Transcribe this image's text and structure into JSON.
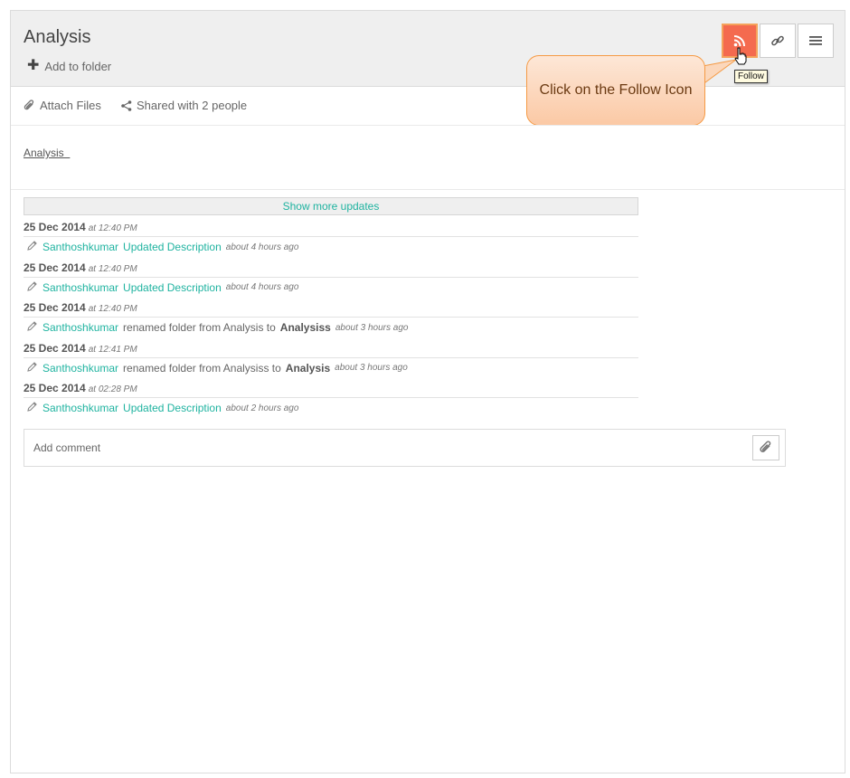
{
  "header": {
    "title": "Analysis",
    "add_to_folder": "Add to folder",
    "follow_tooltip": "Follow",
    "accent_color": "#f46a4f",
    "icons": [
      "rss-icon",
      "link-icon",
      "hamburger-menu-icon"
    ]
  },
  "callout": {
    "text": "Click on the Follow Icon"
  },
  "actions": {
    "attach_files": "Attach Files",
    "shared_with": "Shared with 2 people"
  },
  "description": {
    "link_text": "Analysis  "
  },
  "show_more": "Show more updates",
  "updates": [
    {
      "date": "25 Dec 2014",
      "time": "at 12:40 PM",
      "user": "Santhoshkumar",
      "action": "Updated Description",
      "action_type": "link",
      "ago": "about 4 hours ago"
    },
    {
      "date": "25 Dec 2014",
      "time": "at 12:40 PM",
      "user": "Santhoshkumar",
      "action": "Updated Description",
      "action_type": "link",
      "ago": "about 4 hours ago"
    },
    {
      "date": "25 Dec 2014",
      "time": "at 12:40 PM",
      "user": "Santhoshkumar",
      "action": "renamed folder from Analysis to",
      "target": "Analysiss",
      "action_type": "rename",
      "ago": "about 3 hours ago"
    },
    {
      "date": "25 Dec 2014",
      "time": "at 12:41 PM",
      "user": "Santhoshkumar",
      "action": "renamed folder from Analysiss to",
      "target": "Analysis",
      "action_type": "rename",
      "ago": "about 3 hours ago"
    },
    {
      "date": "25 Dec 2014",
      "time": "at 02:28 PM",
      "user": "Santhoshkumar",
      "action": "Updated Description",
      "action_type": "link",
      "ago": "about 2 hours ago"
    }
  ],
  "comment": {
    "placeholder": "Add comment"
  },
  "colors": {
    "teal": "#1fb3a0",
    "header_bg": "#efefef",
    "callout_border": "#f59a44"
  }
}
